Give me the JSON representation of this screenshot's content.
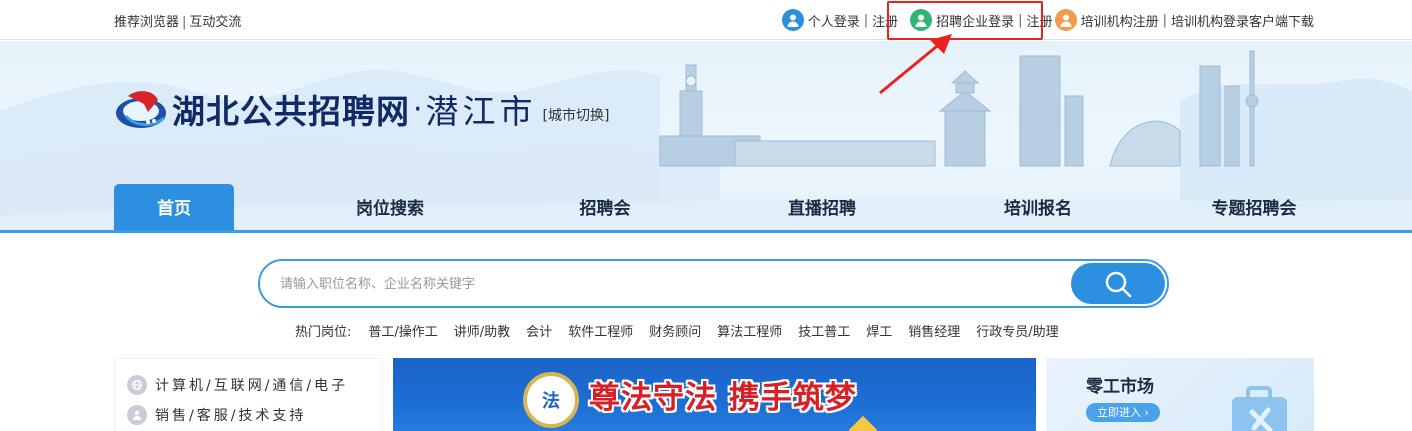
{
  "topbar": {
    "left_links": [
      "推荐浏览器",
      "互动交流"
    ],
    "separator": "|",
    "personal_login": "个人登录",
    "personal_register": "注册",
    "company_login": "招聘企业登录",
    "company_register": "注册",
    "training_register": "培训机构注册",
    "training_login": "培训机构登录",
    "client_download": "客户端下载"
  },
  "header": {
    "logo_title": "湖北公共招聘网",
    "logo_dot": "·",
    "city": "潜江市",
    "city_switch": "[城市切换]"
  },
  "nav": {
    "items": [
      "首页",
      "岗位搜索",
      "招聘会",
      "直播招聘",
      "培训报名",
      "专题招聘会"
    ],
    "active_index": 0
  },
  "search": {
    "placeholder": "请输入职位名称、企业名称关键字",
    "value": ""
  },
  "hot_jobs": {
    "label": "热门岗位:",
    "keywords": [
      "普工/操作工",
      "讲师/助教",
      "会计",
      "软件工程师",
      "财务顾问",
      "算法工程师",
      "技工普工",
      "焊工",
      "销售经理",
      "行政专员/助理"
    ]
  },
  "categories": [
    {
      "label": "计算机/互联网/通信/电子",
      "icon": "globe-icon"
    },
    {
      "label": "销售/客服/技术支持",
      "icon": "person-icon"
    }
  ],
  "promo": {
    "slogan": "尊法守法 携手筑梦",
    "emblem_text": "法"
  },
  "market": {
    "title": "零工市场",
    "enter_label": "立即进入 ›"
  },
  "colors": {
    "primary": "#2c8fe0",
    "highlight": "#e8231f",
    "logo_navy": "#0f2a66"
  }
}
